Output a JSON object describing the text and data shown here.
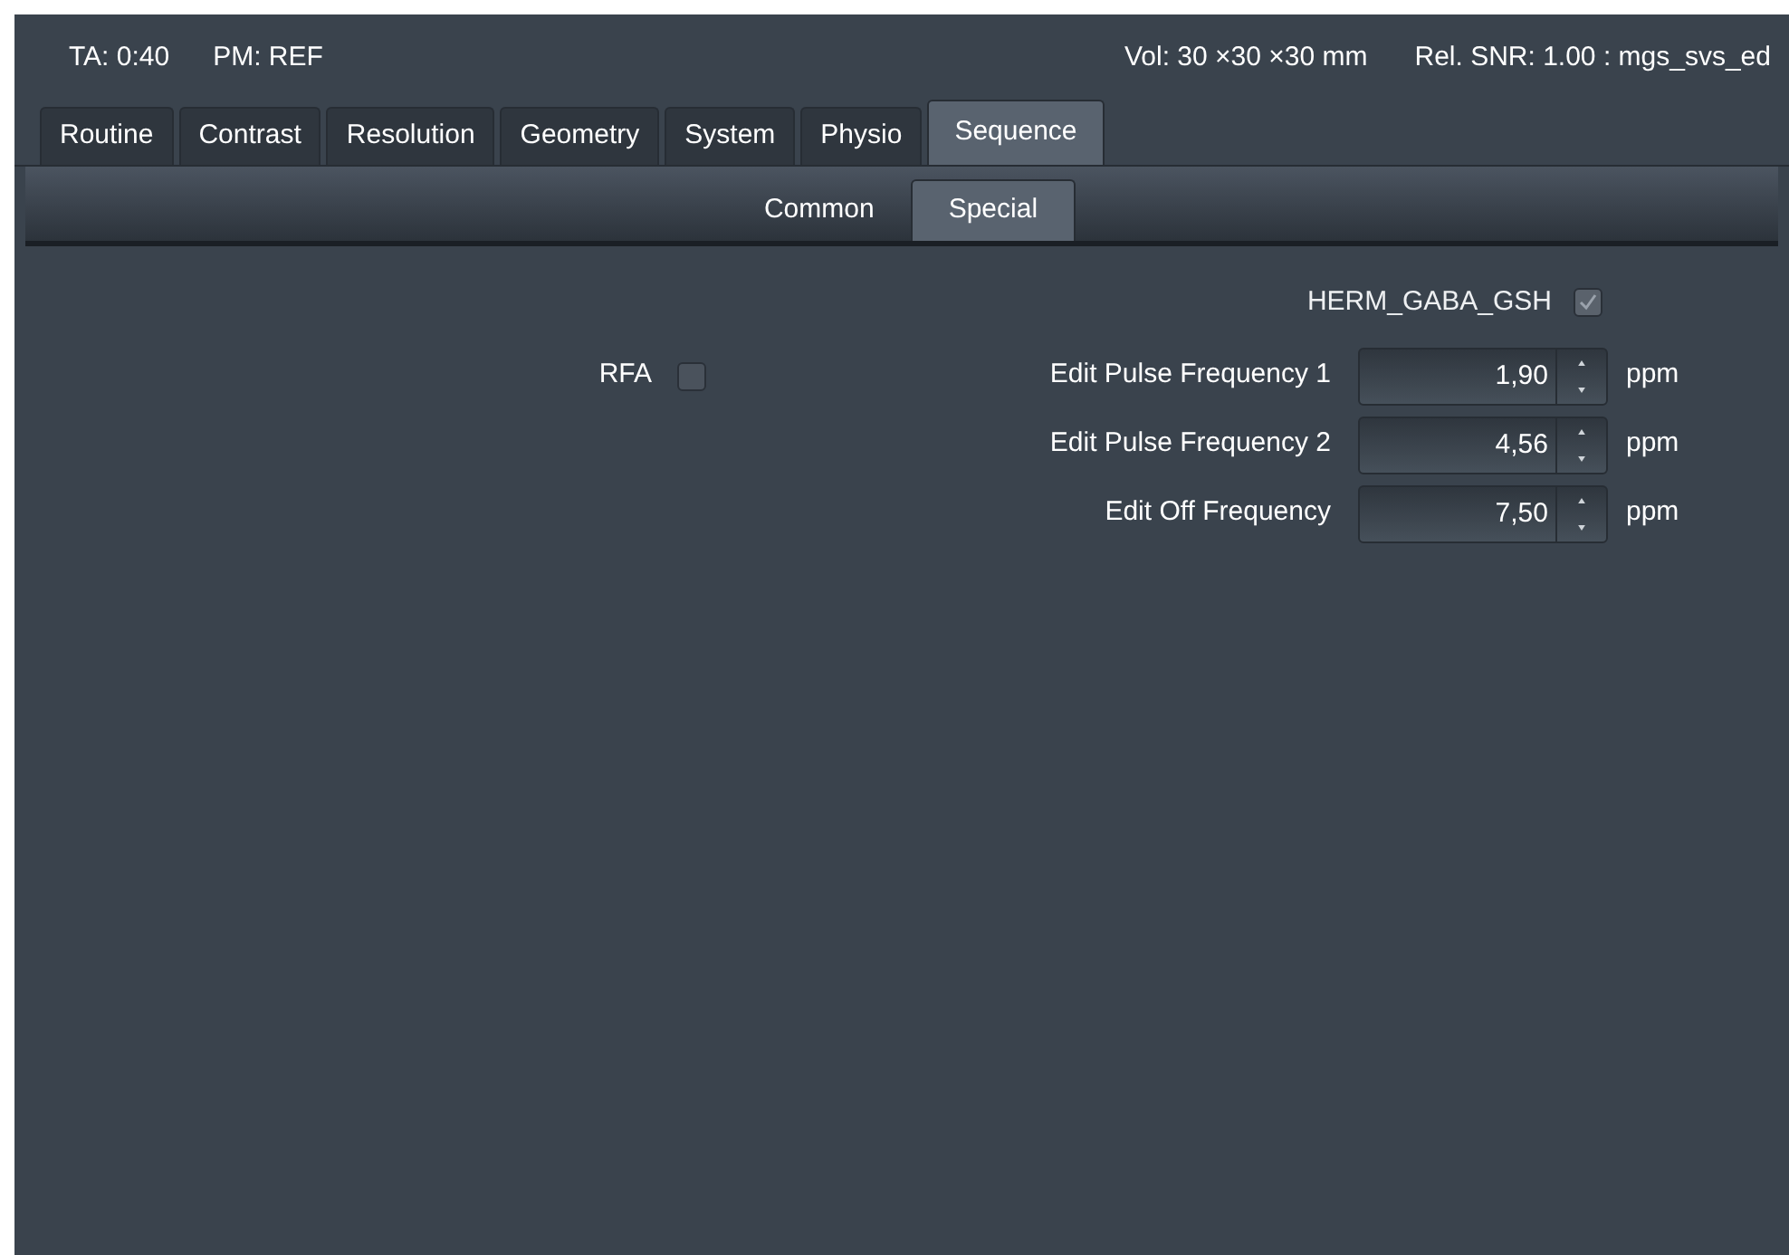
{
  "header": {
    "ta": "TA: 0:40",
    "pm": "PM: REF",
    "vol": "Vol: 30 ×30 ×30 mm",
    "snr": "Rel. SNR: 1.00 : mgs_svs_ed"
  },
  "tabs": [
    {
      "label": "Routine",
      "selected": false
    },
    {
      "label": "Contrast",
      "selected": false
    },
    {
      "label": "Resolution",
      "selected": false
    },
    {
      "label": "Geometry",
      "selected": false
    },
    {
      "label": "System",
      "selected": false
    },
    {
      "label": "Physio",
      "selected": false
    },
    {
      "label": "Sequence",
      "selected": true
    }
  ],
  "subtabs": [
    {
      "label": "Common",
      "selected": false
    },
    {
      "label": "Special",
      "selected": true
    }
  ],
  "herm": {
    "label": "HERM_GABA_GSH",
    "checked": true,
    "disabled": true
  },
  "rfa": {
    "label": "RFA",
    "checked": false,
    "disabled": false
  },
  "params": [
    {
      "label": "Edit Pulse Frequency 1",
      "value": "1,90",
      "unit": "ppm"
    },
    {
      "label": "Edit Pulse Frequency 2",
      "value": "4,56",
      "unit": "ppm"
    },
    {
      "label": "Edit Off Frequency",
      "value": "7,50",
      "unit": "ppm"
    }
  ]
}
